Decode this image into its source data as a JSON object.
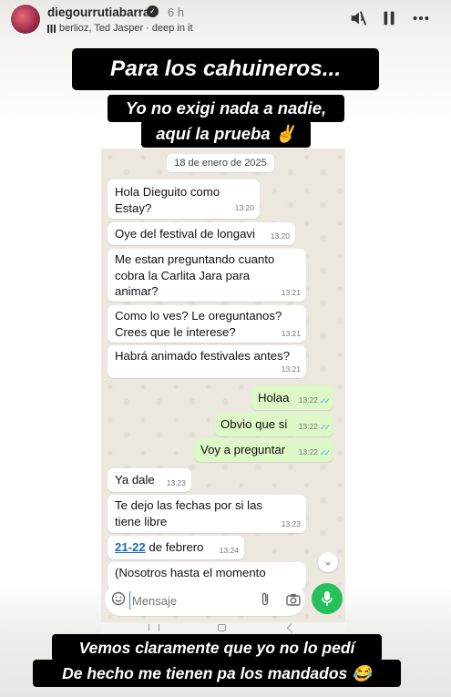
{
  "header": {
    "username": "diegourrutiabarra",
    "time_ago": "6 h",
    "music": "berlioz, Ted Jasper · deep in it",
    "icons": [
      "avatar",
      "verified-badge-icon",
      "music-bars-icon",
      "mute-icon",
      "pause-icon",
      "more-icon"
    ]
  },
  "captions": {
    "title": "Para los cahuineros...",
    "line1": "Yo no exigi nada a nadie,",
    "line2": "aquí la prueba ✌️",
    "bottom1": "Vemos claramente que yo no lo pedí",
    "bottom2": "De hecho me tienen pa los mandados 😂"
  },
  "chat": {
    "date": "18 de enero de 2025",
    "messages": [
      {
        "dir": "in",
        "text": "Hola Dieguito como\nEstay?",
        "time": "13:20"
      },
      {
        "dir": "in",
        "text": "Oye del festival de longavi",
        "time": "13:20"
      },
      {
        "dir": "in",
        "text": "Me estan preguntando cuanto\ncobra la Carlita Jara para\nanimar?",
        "time": "13:21"
      },
      {
        "dir": "in",
        "text": "Como lo ves? Le oreguntanos?\nCrees que le interese?",
        "time": "13:21"
      },
      {
        "dir": "in",
        "text": "Habrá animado festivales antes?",
        "time": "13:21"
      },
      {
        "dir": "out",
        "text": "Holaa",
        "time": "13:22"
      },
      {
        "dir": "out",
        "text": "Obvio que si",
        "time": "13:22"
      },
      {
        "dir": "out",
        "text": "Voy a preguntar",
        "time": "13:22"
      },
      {
        "dir": "in",
        "text": "Ya dale",
        "time": "13:23"
      },
      {
        "dir": "in",
        "text": "Te dejo las fechas por si las\ntiene libre",
        "time": "13:23"
      },
      {
        "dir": "in",
        "link": "21-22",
        "text": " de febrero",
        "time": "13:24"
      },
      {
        "dir": "in",
        "text": "(Nosotros hasta el momento",
        "time": ""
      }
    ],
    "input_placeholder": "Mensaje",
    "icons": [
      "emoji-icon",
      "clip-icon",
      "camera-icon",
      "mic-icon",
      "chevron-down-icon"
    ]
  },
  "colors": {
    "caption_bg": "#000000",
    "incoming_bubble": "#ffffff",
    "outgoing_bubble": "#dcf8c6",
    "read_ticks": "#34b7f1",
    "mic_button": "#25c05c"
  }
}
